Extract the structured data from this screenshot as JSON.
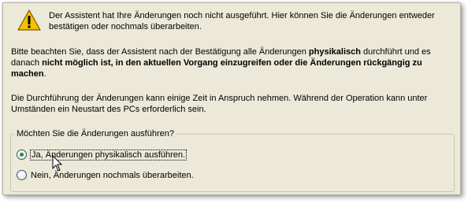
{
  "intro_text": "Der Assistent hat Ihre Änderungen noch nicht ausgeführt. Hier können Sie die Änderungen entweder bestätigen oder nochmals überarbeiten.",
  "notice": {
    "part1": "Bitte beachten Sie, dass der Assistent nach der Bestätigung alle Änderungen ",
    "bold1": "physikalisch",
    "part2": " durchführt und es danach ",
    "bold2": "nicht möglich ist, in den aktuellen Vorgang einzugreifen oder die Änderungen rückgängig zu machen",
    "end": "."
  },
  "duration_text": "Die Durchführung der Änderungen kann einige Zeit in Anspruch nehmen. Während der Operation kann unter Umständen ein Neustart des PCs erforderlich sein.",
  "group": {
    "legend": "Möchten Sie die Änderungen ausführen?",
    "options": [
      {
        "label": "Ja, Änderungen physikalisch ausführen.",
        "selected": true
      },
      {
        "label": "Nein, Änderungen nochmals überarbeiten.",
        "selected": false
      }
    ]
  },
  "icons": {
    "warning": "warning-triangle-icon",
    "cursor": "mouse-pointer-icon"
  },
  "colors": {
    "background": "#ece9d8",
    "radio_dot": "#2e8b2e",
    "warning_fill": "#f7c000"
  }
}
